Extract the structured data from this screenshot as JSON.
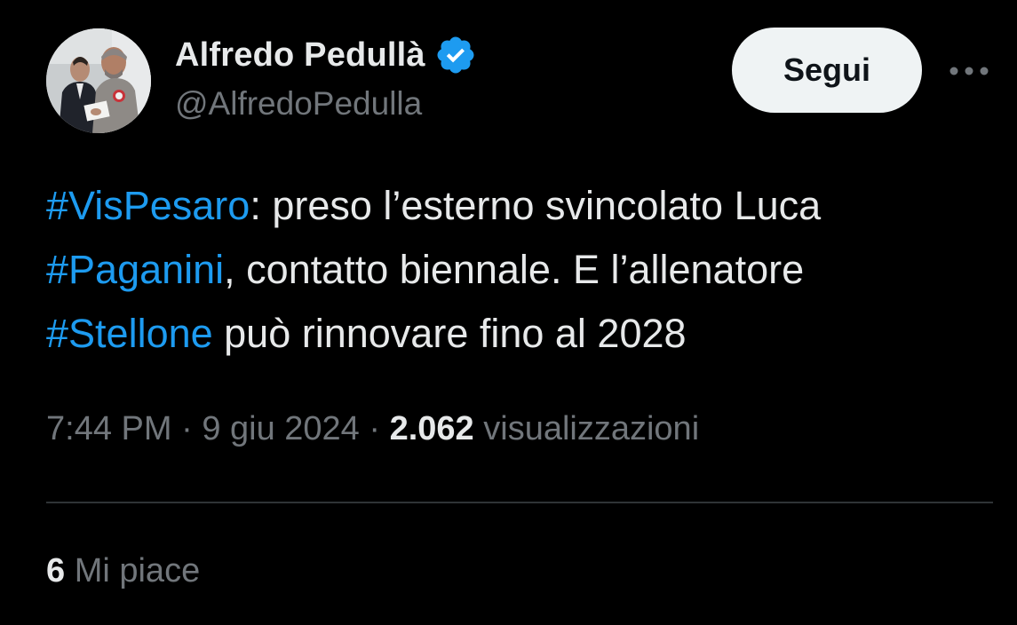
{
  "author": {
    "display_name": "Alfredo Pedullà",
    "handle": "@AlfredoPedulla",
    "verified": true,
    "avatar_icon": "profile-photo"
  },
  "actions": {
    "follow_label": "Segui",
    "more_icon": "more-dots-icon"
  },
  "tweet": {
    "segments": [
      {
        "type": "hashtag",
        "text": "#VisPesaro"
      },
      {
        "type": "text",
        "text": ": preso l’esterno svincolato Luca "
      },
      {
        "type": "hashtag",
        "text": "#Paganini"
      },
      {
        "type": "text",
        "text": ", contatto biennale. E l’allenatore "
      },
      {
        "type": "hashtag",
        "text": "#Stellone"
      },
      {
        "type": "text",
        "text": " può rinnovare fino al 2028"
      }
    ]
  },
  "meta": {
    "time": "7:44 PM",
    "separator": " · ",
    "date": "9 giu 2024",
    "views_count": "2.062",
    "views_label": "visualizzazioni"
  },
  "engagement": {
    "likes_count": "6",
    "likes_label": "Mi piace"
  },
  "colors": {
    "background": "#000000",
    "text": "#e7e9ea",
    "secondary": "#71767b",
    "accent": "#1d9bf0",
    "button_bg": "#eff3f4",
    "divider": "#2f3336"
  }
}
